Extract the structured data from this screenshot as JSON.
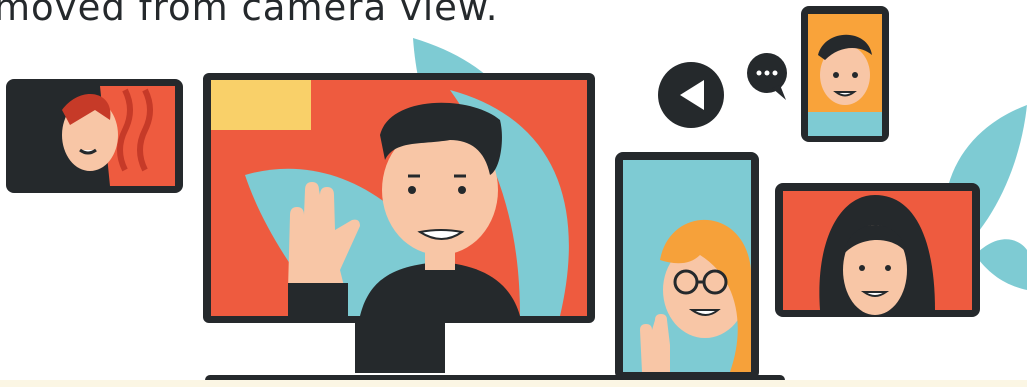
{
  "caption": {
    "text": "moved from camera view."
  },
  "colors": {
    "frame": "#25292c",
    "orange": "#ee5b3f",
    "teal": "#7ecbd3",
    "skin": "#f8c6a6",
    "yellow": "#f9d069",
    "hair_blonde": "#f6a13a",
    "leaf": "#7ecbd3"
  },
  "icons": [
    "play-icon",
    "chat-bubble-icon"
  ]
}
